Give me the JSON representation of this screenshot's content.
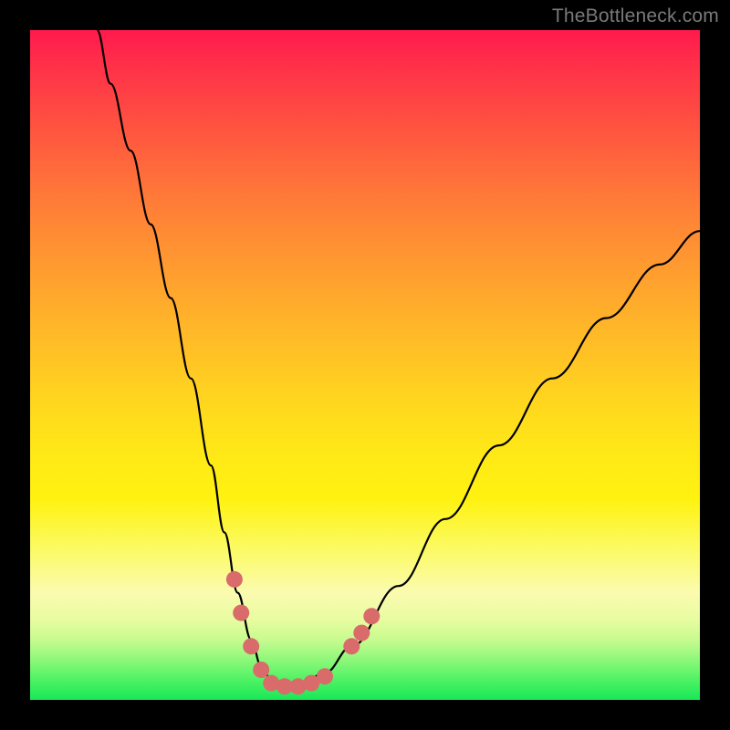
{
  "watermark": "TheBottleneck.com",
  "chart_data": {
    "type": "line",
    "title": "",
    "xlabel": "",
    "ylabel": "",
    "xlim": [
      0,
      100
    ],
    "ylim": [
      0,
      100
    ],
    "series": [
      {
        "name": "bottleneck-curve",
        "x": [
          10,
          12,
          15,
          18,
          21,
          24,
          27,
          29,
          31,
          33,
          34.5,
          36,
          38,
          40,
          44,
          48,
          55,
          62,
          70,
          78,
          86,
          94,
          100
        ],
        "y": [
          100,
          92,
          82,
          71,
          60,
          48,
          35,
          25,
          16,
          9,
          5,
          3,
          2,
          2,
          4,
          8,
          17,
          27,
          38,
          48,
          57,
          65,
          70
        ]
      }
    ],
    "markers": {
      "name": "highlight-dots",
      "color": "#d96b6b",
      "points": [
        {
          "x": 30.5,
          "y": 18
        },
        {
          "x": 31.5,
          "y": 13
        },
        {
          "x": 33.0,
          "y": 8
        },
        {
          "x": 34.5,
          "y": 4.5
        },
        {
          "x": 36.0,
          "y": 2.5
        },
        {
          "x": 38.0,
          "y": 2
        },
        {
          "x": 40.0,
          "y": 2
        },
        {
          "x": 42.0,
          "y": 2.5
        },
        {
          "x": 44.0,
          "y": 3.5
        },
        {
          "x": 48.0,
          "y": 8
        },
        {
          "x": 49.5,
          "y": 10
        },
        {
          "x": 51.0,
          "y": 12.5
        }
      ]
    },
    "colors": {
      "curve": "#000000",
      "marker": "#d96b6b",
      "gradient_top": "#ff1a4d",
      "gradient_bottom": "#18e858"
    }
  }
}
